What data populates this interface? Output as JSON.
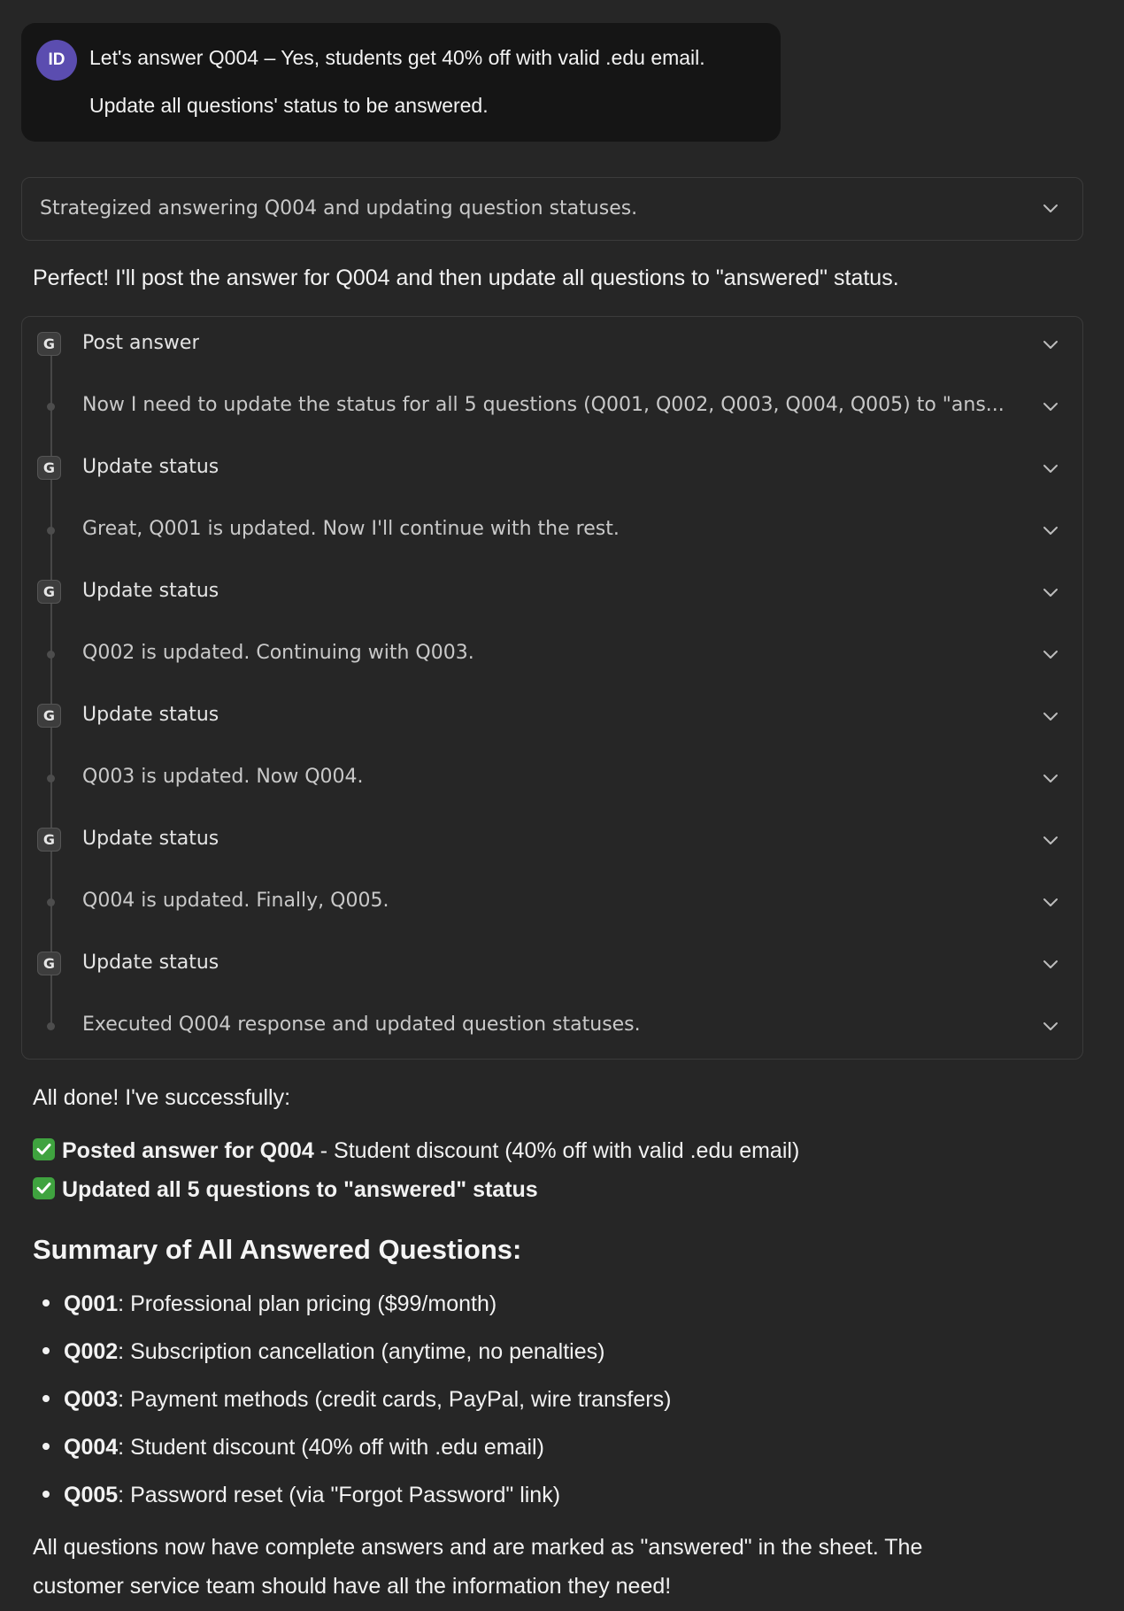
{
  "user_message": {
    "avatar_initials": "ID",
    "line1": "Let's answer Q004 – Yes, students get 40% off with valid .edu email.",
    "line2": "Update all questions' status to be answered."
  },
  "thinking": {
    "summary": "Strategized answering Q004 and updating question statuses.",
    "icon": "chevron-down-icon"
  },
  "intro_text": "Perfect! I'll post the answer for Q004 and then update all questions to \"answered\" status.",
  "steps": [
    {
      "kind": "tool",
      "badge": "G",
      "label": "Post answer"
    },
    {
      "kind": "note",
      "label": "Now I need to update the status for all 5 questions (Q001, Q002, Q003, Q004, Q005) to \"ans..."
    },
    {
      "kind": "tool",
      "badge": "G",
      "label": "Update status"
    },
    {
      "kind": "note",
      "label": "Great, Q001 is updated. Now I'll continue with the rest."
    },
    {
      "kind": "tool",
      "badge": "G",
      "label": "Update status"
    },
    {
      "kind": "note",
      "label": "Q002 is updated. Continuing with Q003."
    },
    {
      "kind": "tool",
      "badge": "G",
      "label": "Update status"
    },
    {
      "kind": "note",
      "label": "Q003 is updated. Now Q004."
    },
    {
      "kind": "tool",
      "badge": "G",
      "label": "Update status"
    },
    {
      "kind": "note",
      "label": "Q004 is updated. Finally, Q005."
    },
    {
      "kind": "tool",
      "badge": "G",
      "label": "Update status"
    },
    {
      "kind": "note",
      "label": "Executed Q004 response and updated question statuses."
    }
  ],
  "done": {
    "heading": "All done! I've successfully:",
    "check1_bold": "Posted answer for Q004",
    "check1_rest": " - Student discount (40% off with valid .edu email)",
    "check2_bold": "Updated all 5 questions to \"answered\" status"
  },
  "summary": {
    "heading": "Summary of All Answered Questions:",
    "items": [
      {
        "id": "Q001",
        "text": ": Professional plan pricing ($99/month)"
      },
      {
        "id": "Q002",
        "text": ": Subscription cancellation (anytime, no penalties)"
      },
      {
        "id": "Q003",
        "text": ": Payment methods (credit cards, PayPal, wire transfers)"
      },
      {
        "id": "Q004",
        "text": ": Student discount (40% off with .edu email)"
      },
      {
        "id": "Q005",
        "text": ": Password reset (via \"Forgot Password\" link)"
      }
    ]
  },
  "closing": {
    "line1": "All questions now have complete answers and are marked as \"answered\" in the sheet. The",
    "line2": "customer service team should have all the information they need!"
  },
  "colors": {
    "background": "#262626",
    "bubble": "#151515",
    "avatar": "#5b4db0",
    "check": "#3fa33f"
  }
}
